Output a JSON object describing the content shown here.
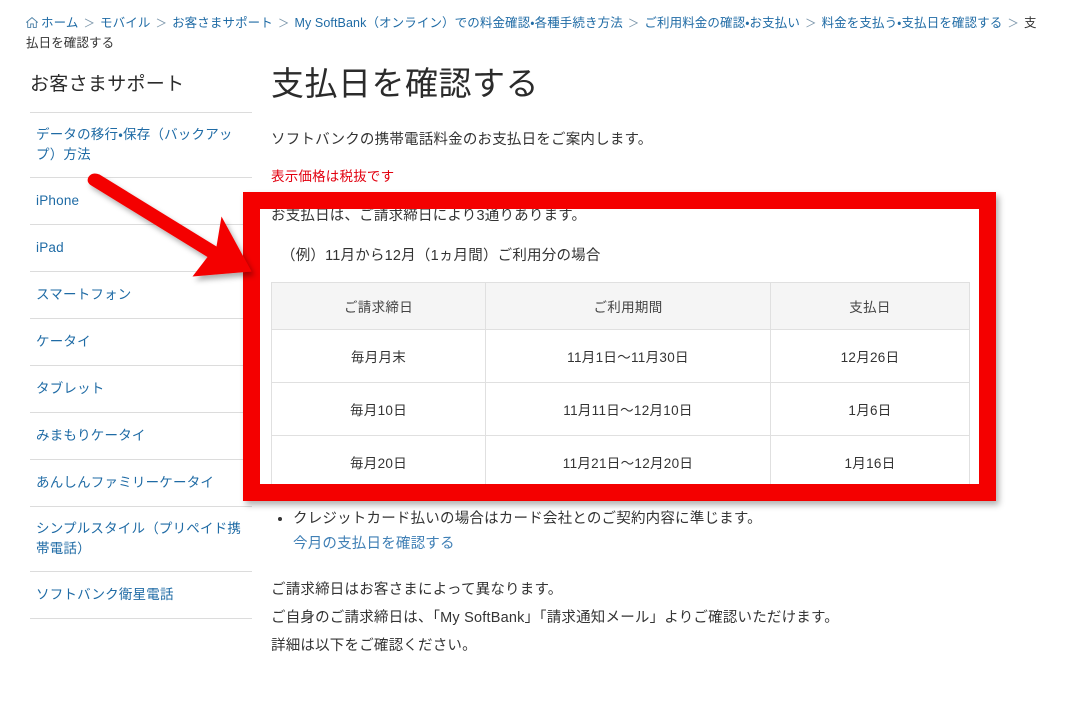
{
  "breadcrumb": {
    "home_icon": "home-icon",
    "separator": "＞",
    "items": [
      {
        "label": "ホーム",
        "current": false
      },
      {
        "label": "モバイル",
        "current": false
      },
      {
        "label": "お客さまサポート",
        "current": false
      },
      {
        "label": "My SoftBank（オンライン）での料金確認・各種手続き方法",
        "current": false
      },
      {
        "label": "ご利用料金の確認・お支払い",
        "current": false
      },
      {
        "label": "料金を支払う・支払日を確認する",
        "current": false
      },
      {
        "label": "支払日を確認する",
        "current": true
      }
    ]
  },
  "sidebar": {
    "title": "お客さまサポート",
    "items": [
      {
        "label": "データの移行・保存（バックアップ）方法"
      },
      {
        "label": "iPhone"
      },
      {
        "label": "iPad"
      },
      {
        "label": "スマートフォン"
      },
      {
        "label": "ケータイ"
      },
      {
        "label": "タブレット"
      },
      {
        "label": "みまもりケータイ"
      },
      {
        "label": "あんしんファミリーケータイ"
      },
      {
        "label": "シンプルスタイル（プリペイド携帯電話）"
      },
      {
        "label": "ソフトバンク衛星電話"
      }
    ]
  },
  "main": {
    "title": "支払日を確認する",
    "lead": "ソフトバンクの携帯電話料金のお支払日をご案内します。",
    "tax_note": "表示価格は税抜です",
    "intro": "お支払日は、ご請求締日により3通りあります。",
    "example_caption": "（例）11月から12月（1ヵ月間）ご利用分の場合",
    "table": {
      "headers": [
        "ご請求締日",
        "ご利用期間",
        "支払日"
      ],
      "rows": [
        [
          "毎月月末",
          "11月1日〜11月30日",
          "12月26日"
        ],
        [
          "毎月10日",
          "11月11日〜12月10日",
          "1月6日"
        ],
        [
          "毎月20日",
          "11月21日〜12月20日",
          "1月16日"
        ]
      ]
    },
    "notes": [
      "クレジットカード払いの場合はカード会社とのご契約内容に準じます。"
    ],
    "note_link": "今月の支払日を確認する",
    "tail": [
      "ご請求締日はお客さまによって異なります。",
      "ご自身のご請求締日は、「My SoftBank」「請求通知メール」よりご確認いただけます。",
      "詳細は以下をご確認ください。"
    ]
  },
  "annotations": {
    "highlight_color": "#f40000",
    "arrow_name": "red-arrow-pointing-to-table",
    "box_name": "red-highlight-box-around-table"
  }
}
